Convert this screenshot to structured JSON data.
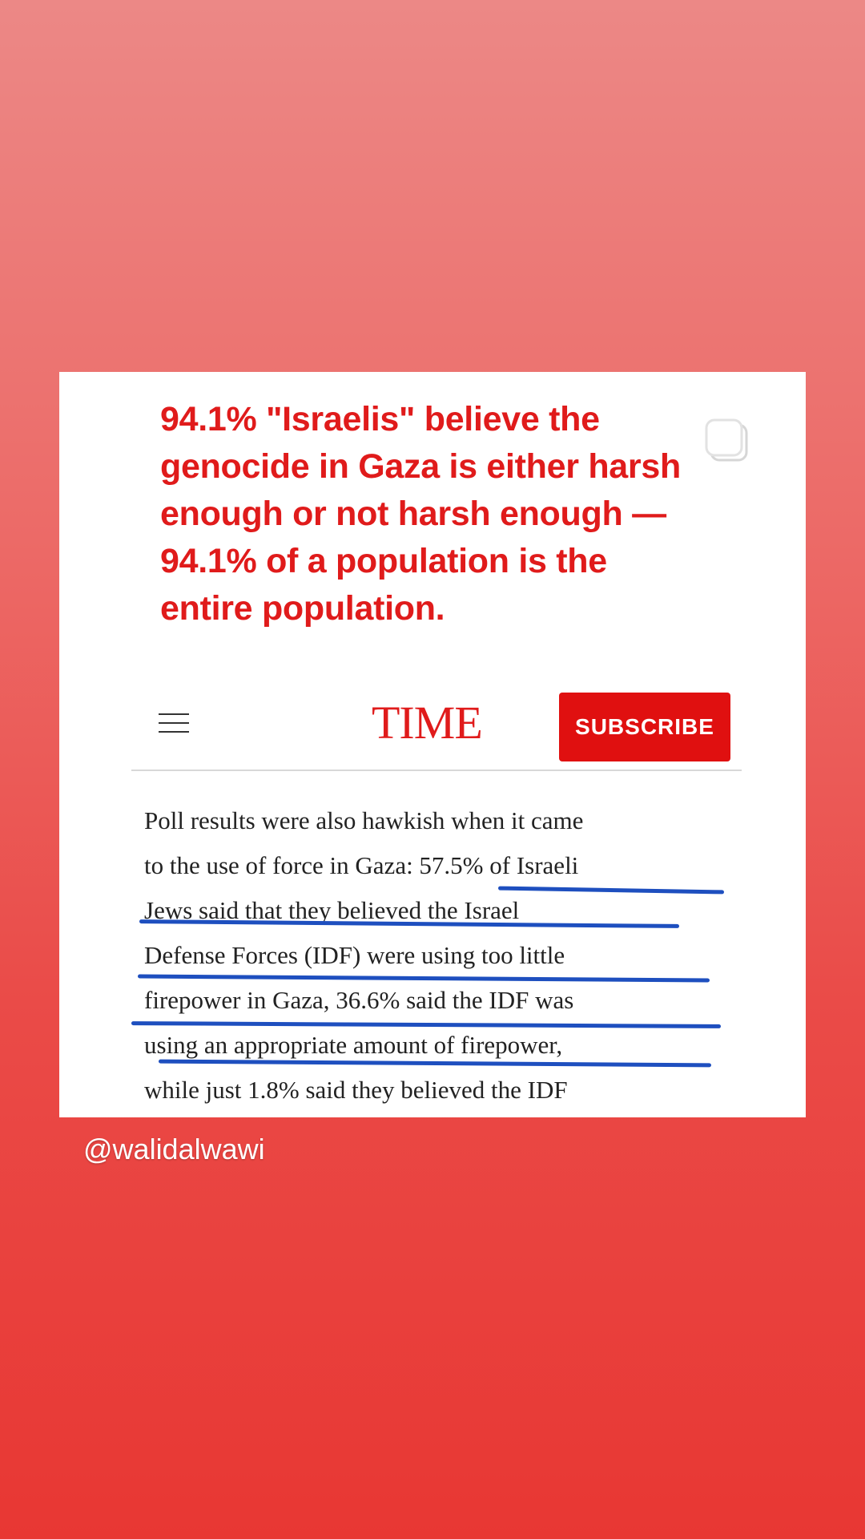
{
  "headline": {
    "lines": [
      "94.1% \"Israelis\" believe the",
      "genocide in Gaza is either harsh",
      "enough or not harsh enough —",
      "94.1% of a population is the",
      "entire population."
    ],
    "color": "#e01b1b"
  },
  "time_header": {
    "menu_icon": "hamburger-menu-icon",
    "logo": "TIME",
    "subscribe_label": "SUBSCRIBE",
    "brand_color": "#e01010"
  },
  "article": {
    "lines": [
      "Poll results were also hawkish when it came",
      "to the use of force in Gaza: 57.5% of Israeli",
      "Jews said that they believed the Israel",
      "Defense Forces (IDF) were using too little",
      "firepower in Gaza, 36.6% said the IDF was",
      "using an appropriate amount of firepower,",
      "while just 1.8% said they believed the IDF"
    ],
    "highlight_color": "#1e4fbf"
  },
  "overlay": {
    "handle": "@walidalwawi",
    "copy_icon": "copy-icon"
  }
}
